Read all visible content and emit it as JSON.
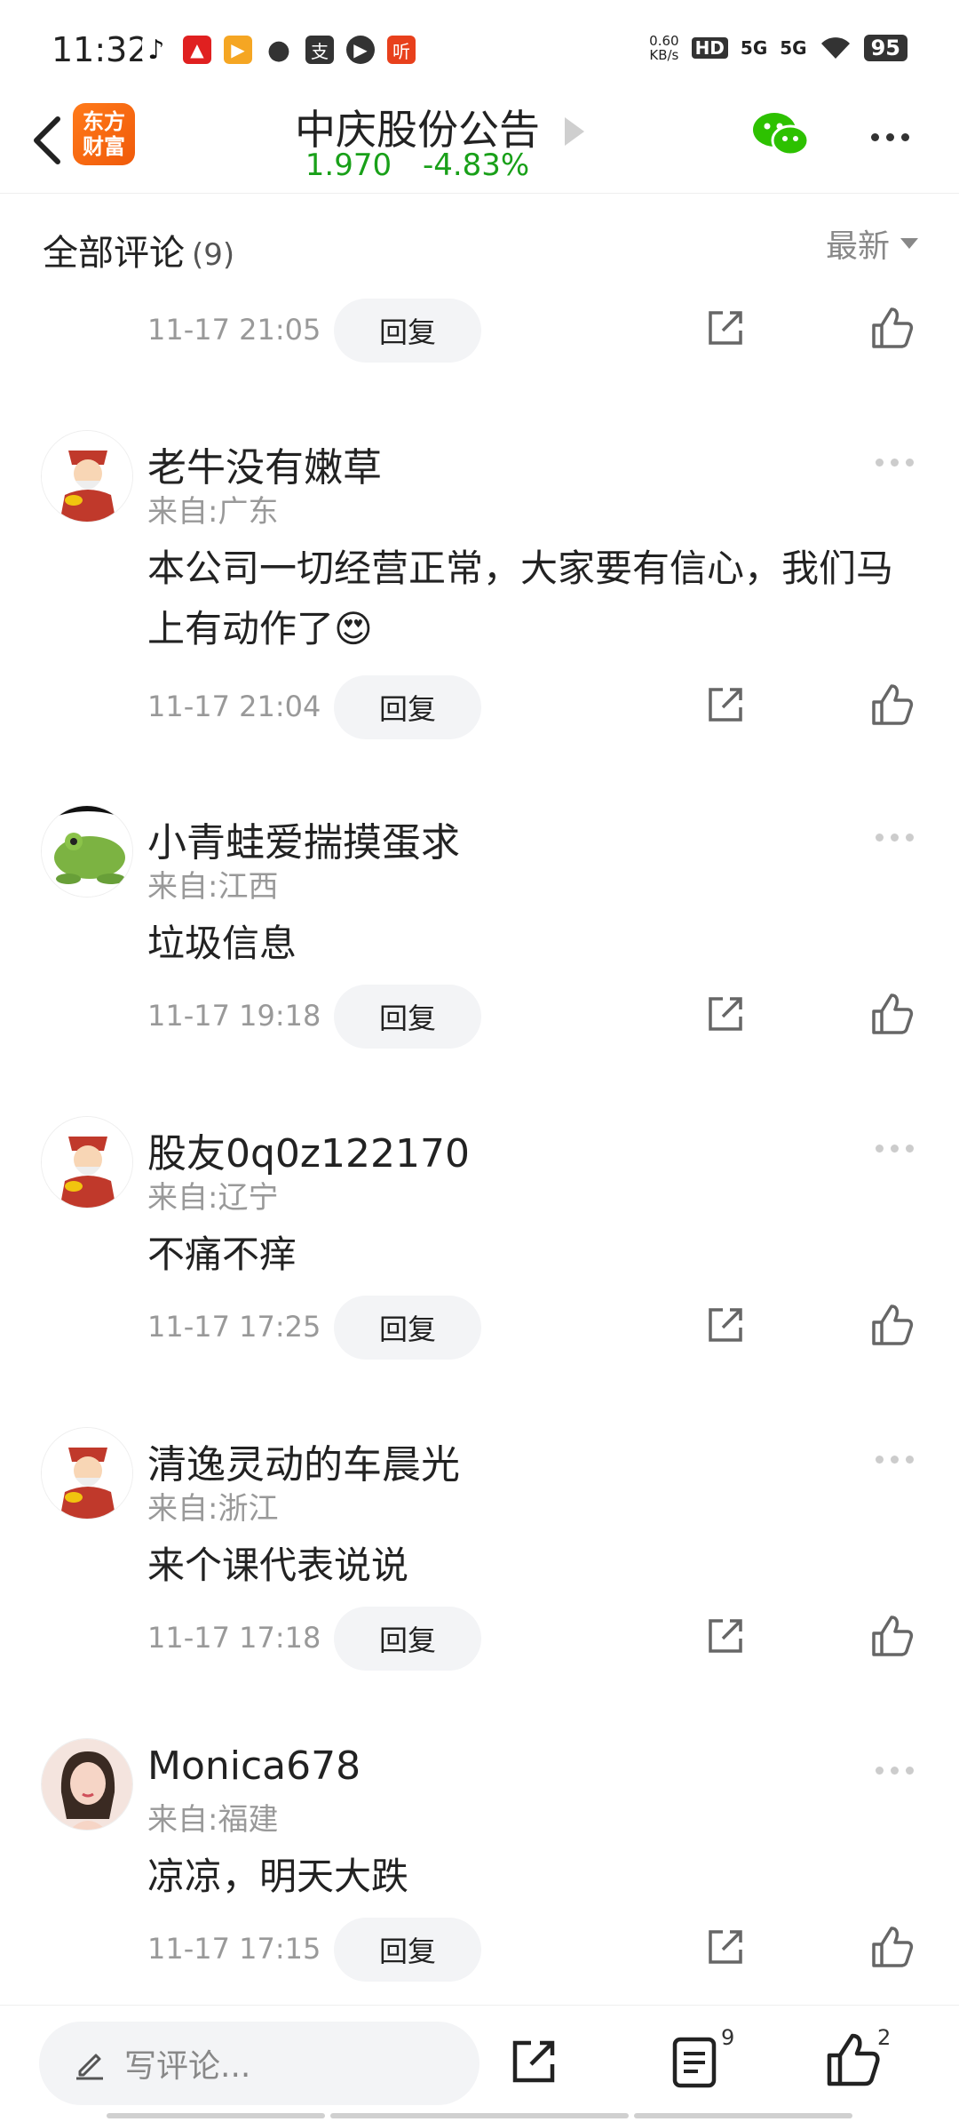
{
  "status_bar": {
    "time": "11:32",
    "net_speed_value": "0.60",
    "net_speed_unit": "KB/s",
    "hd_label": "HD",
    "signal_1": "5G",
    "signal_2": "5G",
    "battery": "95"
  },
  "header": {
    "logo_text": "东方财富",
    "title": "中庆股份公告",
    "price": "1.970",
    "change_pct": "-4.83%",
    "price_color": "#19a019"
  },
  "section": {
    "title": "全部评论",
    "count": "(9)",
    "sort_label": "最新"
  },
  "comments": [
    {
      "username": "",
      "location": "",
      "content": "",
      "time": "11-17 21:05",
      "reply_label": "回复"
    },
    {
      "username": "老牛没有嫩草",
      "location": "来自:广东",
      "content": "本公司一切经营正常，大家要有信心，我们马上有动作了😍",
      "time": "11-17 21:04",
      "reply_label": "回复",
      "avatar": "fortune-god-avatar"
    },
    {
      "username": "小青蛙爱揣摸蛋求",
      "location": "来自:江西",
      "content": "垃圾信息",
      "time": "11-17 19:18",
      "reply_label": "回复",
      "avatar": "frog-avatar"
    },
    {
      "username": "股友0q0z122170",
      "location": "来自:辽宁",
      "content": "不痛不痒",
      "time": "11-17 17:25",
      "reply_label": "回复",
      "avatar": "fortune-god-avatar"
    },
    {
      "username": "清逸灵动的车晨光",
      "location": "来自:浙江",
      "content": "来个课代表说说",
      "time": "11-17 17:18",
      "reply_label": "回复",
      "avatar": "fortune-god-avatar"
    },
    {
      "username": "Monica678",
      "location": "来自:福建",
      "content": "凉凉，明天大跌",
      "time": "11-17 17:15",
      "reply_label": "回复",
      "avatar": "woman-avatar"
    }
  ],
  "bottom_bar": {
    "input_placeholder": "写评论...",
    "comment_count": "9",
    "like_count": "2"
  }
}
